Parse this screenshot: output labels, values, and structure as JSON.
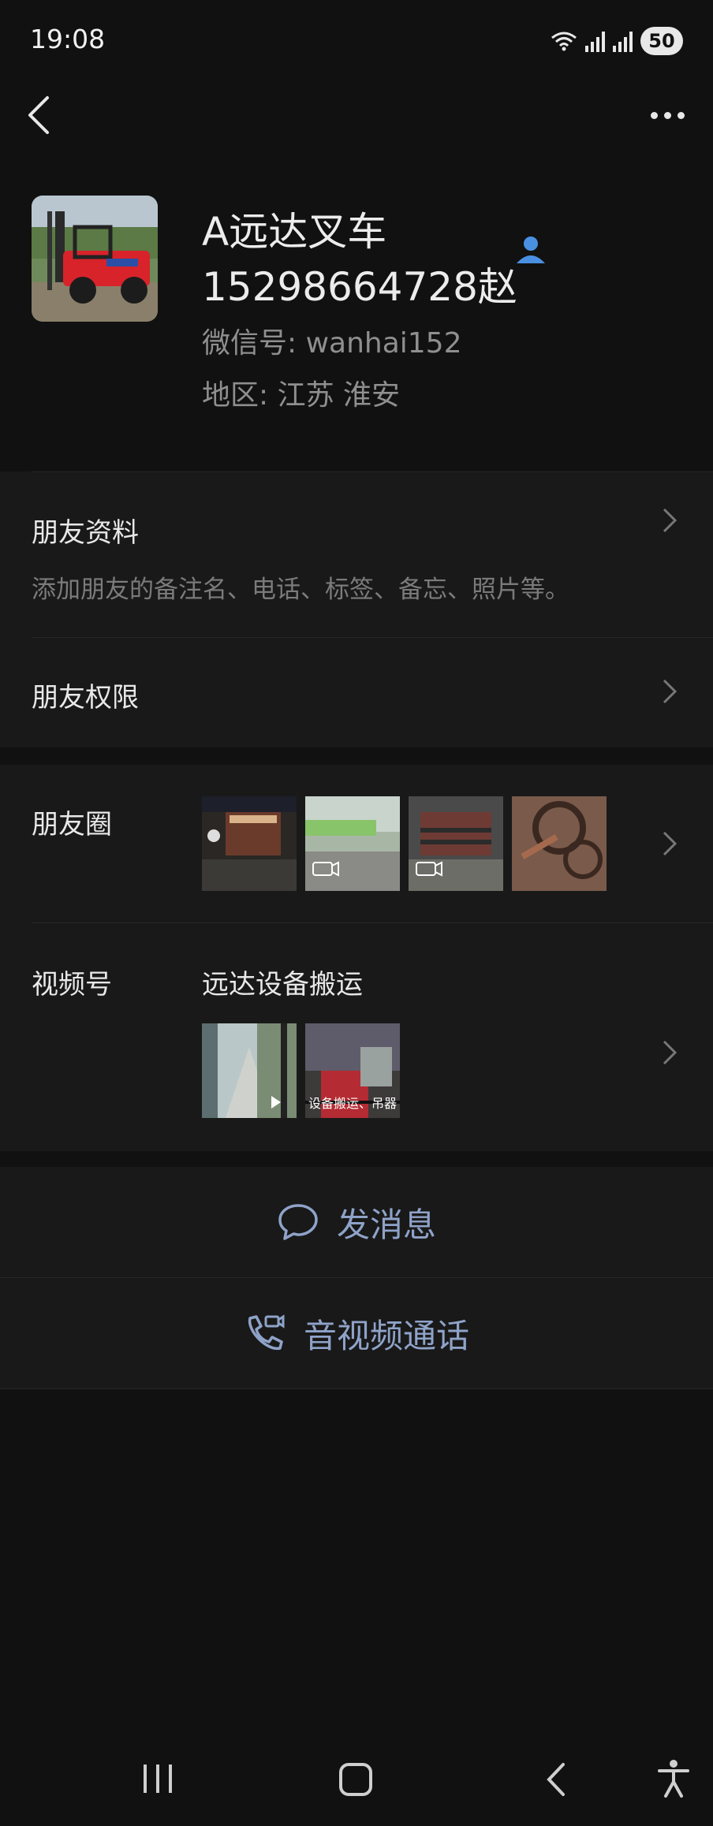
{
  "status_bar": {
    "time": "19:08",
    "battery": "50"
  },
  "profile": {
    "name_line1": "A远达叉车",
    "name_line2": "15298664728赵",
    "wechat_id": "微信号: wanhai152",
    "region": "地区: 江苏  淮安"
  },
  "friend_info": {
    "title": "朋友资料",
    "subtitle": "添加朋友的备注名、电话、标签、备忘、照片等。"
  },
  "permissions": {
    "title": "朋友权限"
  },
  "moments": {
    "title": "朋友圈"
  },
  "channels": {
    "title": "视频号",
    "name": "远达设备搬运",
    "thumb2_caption": "设备搬运、吊器"
  },
  "actions": {
    "message": "发消息",
    "call": "音视频通话"
  },
  "colors": {
    "background": "#111111",
    "card": "#191919",
    "accent": "#8fa3c9",
    "contact_icon": "#4a90e2"
  }
}
